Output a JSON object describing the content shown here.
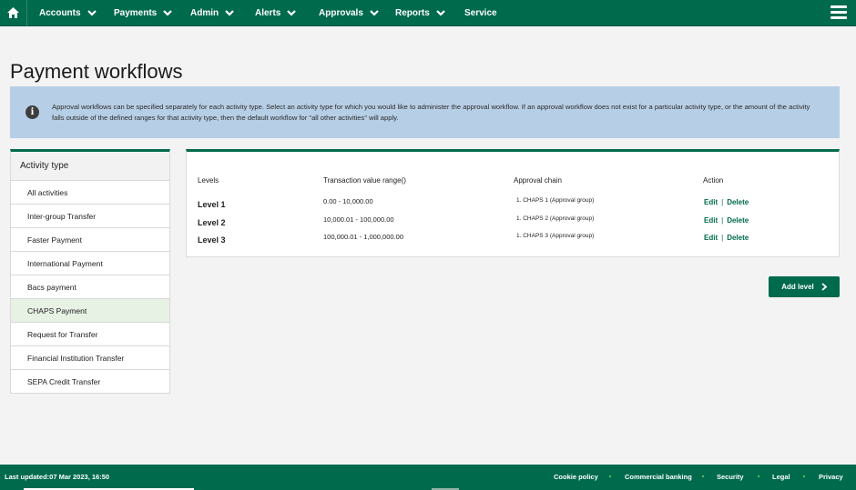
{
  "nav": {
    "items": [
      {
        "label": "Accounts",
        "has_dropdown": true
      },
      {
        "label": "Payments",
        "has_dropdown": true
      },
      {
        "label": "Admin",
        "has_dropdown": true
      },
      {
        "label": "Alerts",
        "has_dropdown": true
      },
      {
        "label": "Approvals",
        "has_dropdown": true
      },
      {
        "label": "Reports",
        "has_dropdown": true
      },
      {
        "label": "Service",
        "has_dropdown": false
      }
    ],
    "home_icon": "home-icon",
    "menu_icon": "hamburger-menu-icon"
  },
  "page": {
    "title": "Payment workflows",
    "info_text": "Approval workflows can be specified separately for each activity type. Select an activity type for which you would like to administer the approval workflow. If an approval workflow does not exist for a particular activity type, or the amount of the activity falls outside of the defined ranges for that activity type, then the default workflow for \"all other activities\" will apply."
  },
  "sidebar": {
    "heading": "Activity type",
    "items": [
      {
        "label": "All activities"
      },
      {
        "label": "Inter-group Transfer"
      },
      {
        "label": "Faster Payment"
      },
      {
        "label": "International Payment"
      },
      {
        "label": "Bacs payment"
      },
      {
        "label": "CHAPS Payment",
        "selected": true
      },
      {
        "label": "Request for Transfer"
      },
      {
        "label": "Financial Institution Transfer"
      },
      {
        "label": "SEPA Credit Transfer"
      }
    ]
  },
  "table": {
    "headers": [
      "Levels",
      "Transaction value range()",
      "Approval chain",
      "Action"
    ],
    "rows": [
      {
        "level": "Level 1",
        "range": "0.00 - 10,000.00",
        "chain": "1. CHAPS 1 (Approval group)",
        "edit": "Edit",
        "delete": "Delete"
      },
      {
        "level": "Level 2",
        "range": "10,000.01 - 100,000.00",
        "chain": "1. CHAPS 2 (Approval group)",
        "edit": "Edit",
        "delete": "Delete"
      },
      {
        "level": "Level 3",
        "range": "100,000.01 - 1,000,000.00",
        "chain": "1. CHAPS 3 (Approval group)",
        "edit": "Edit",
        "delete": "Delete"
      }
    ],
    "separator": "|"
  },
  "add_level_label": "Add level",
  "footer": {
    "last_updated": "Last updated:07 Mar 2023, 16:50",
    "links": [
      "Cookie policy",
      "Commercial banking",
      "Security",
      "Legal",
      "Privacy"
    ]
  },
  "colors": {
    "brand_green": "#006a4d",
    "info_banner": "#b7cfe6",
    "selected_row": "#e7f1e4",
    "footer_dot": "#7ed36b"
  }
}
